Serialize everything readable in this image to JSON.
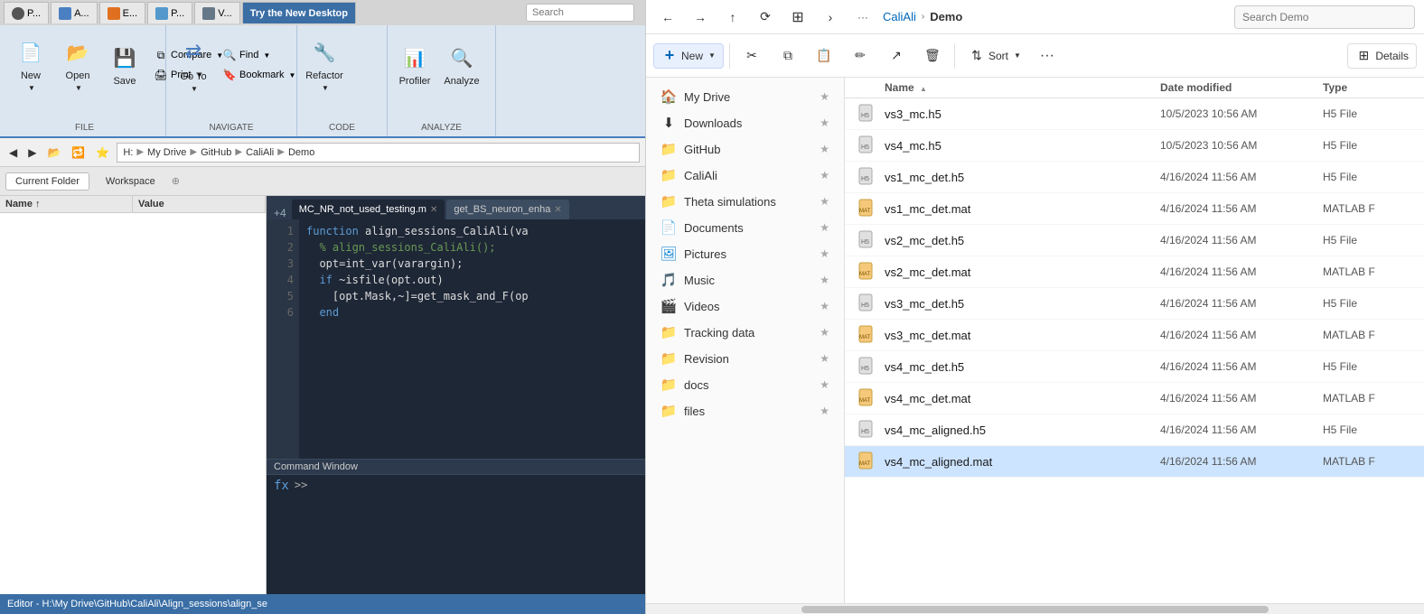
{
  "tabs": [
    {
      "id": "p1",
      "label": "P...",
      "active": false
    },
    {
      "id": "a1",
      "label": "A...",
      "active": false
    },
    {
      "id": "e1",
      "label": "E...",
      "active": false
    },
    {
      "id": "p2",
      "label": "P...",
      "active": false
    },
    {
      "id": "v1",
      "label": "V...",
      "active": false
    },
    {
      "id": "try",
      "label": "Try the New Desktop",
      "active": true,
      "highlight": true
    }
  ],
  "ribbon": {
    "search_placeholder": "Search",
    "groups": [
      {
        "label": "FILE",
        "buttons_large": [
          {
            "id": "new",
            "label": "New",
            "icon": "📄"
          },
          {
            "id": "open",
            "label": "Open",
            "icon": "📂"
          },
          {
            "id": "save",
            "label": "Save",
            "icon": "💾"
          }
        ],
        "buttons_small": [
          {
            "id": "compare",
            "label": "Compare"
          },
          {
            "id": "print",
            "label": "Print"
          }
        ]
      },
      {
        "label": "NAVIGATE",
        "buttons_large": [
          {
            "id": "goto",
            "label": "Go To",
            "icon": "→"
          }
        ],
        "buttons_small": [
          {
            "id": "find",
            "label": "Find"
          },
          {
            "id": "bookmark",
            "label": "Bookmark"
          }
        ]
      },
      {
        "label": "CODE",
        "buttons_large": [
          {
            "id": "refactor",
            "label": "Refactor",
            "icon": "🔧"
          }
        ]
      },
      {
        "label": "ANALYZE",
        "buttons_large": [
          {
            "id": "profiler",
            "label": "Profiler",
            "icon": "📊"
          },
          {
            "id": "analyze",
            "label": "Analyze",
            "icon": "🔍"
          }
        ]
      }
    ]
  },
  "address_bar": {
    "path_parts": [
      "H:",
      "My Drive",
      "GitHub",
      "CaliAli",
      "Demo"
    ],
    "nav_buttons": [
      "◀",
      "▶",
      "▲",
      "⟳"
    ]
  },
  "panels": [
    {
      "id": "current_folder",
      "label": "Current Folder"
    },
    {
      "id": "workspace",
      "label": "Workspace"
    }
  ],
  "variable_panel": {
    "columns": [
      "Name",
      "Value"
    ],
    "rows": []
  },
  "editor": {
    "tabs": [
      {
        "id": "mc_nr",
        "label": "MC_NR_not_used_testing.m",
        "active": true,
        "closeable": true
      },
      {
        "id": "get_bs",
        "label": "get_BS_neuron_enha",
        "active": false,
        "closeable": true
      }
    ],
    "line_indicator": "+4",
    "lines": [
      {
        "num": "1",
        "content": "function align_sessions_CaliAli(va",
        "type": "kw"
      },
      {
        "num": "2",
        "content": "  % align_sessions_CaliAli();",
        "type": "comment"
      },
      {
        "num": "3",
        "content": "  opt=int_var(varargin);",
        "type": "code"
      },
      {
        "num": "4",
        "content": "  if ~isfile(opt.out)",
        "type": "kw"
      },
      {
        "num": "5",
        "content": "    [opt.Mask,~]=get_mask_and_F(op",
        "type": "code"
      },
      {
        "num": "6",
        "content": "  end",
        "type": "kw"
      }
    ]
  },
  "command_window": {
    "title": "Command Window",
    "prompt": ">>"
  },
  "status_bar": {
    "text": "Editor - H:\\My Drive\\GitHub\\CaliAli\\Align_sessions\\align_se"
  },
  "explorer": {
    "nav_buttons": [
      {
        "id": "back",
        "label": "←",
        "disabled": false
      },
      {
        "id": "forward",
        "label": "→",
        "disabled": false
      },
      {
        "id": "up",
        "label": "↑",
        "disabled": false
      },
      {
        "id": "refresh",
        "label": "⟳",
        "disabled": false
      }
    ],
    "breadcrumb": [
      "CaliAli",
      "Demo"
    ],
    "search_placeholder": "Search Demo",
    "toolbar_buttons": [
      {
        "id": "new",
        "label": "New",
        "icon": "+",
        "has_caret": true
      },
      {
        "id": "cut",
        "label": "",
        "icon": "✂",
        "has_caret": false
      },
      {
        "id": "copy",
        "label": "",
        "icon": "⧉",
        "has_caret": false
      },
      {
        "id": "paste",
        "label": "",
        "icon": "📋",
        "has_caret": false
      },
      {
        "id": "rename",
        "label": "",
        "icon": "✏",
        "has_caret": false
      },
      {
        "id": "share",
        "label": "",
        "icon": "↗",
        "has_caret": false
      },
      {
        "id": "delete",
        "label": "",
        "icon": "🗑",
        "has_caret": false
      },
      {
        "id": "sort",
        "label": "Sort",
        "icon": "⇅",
        "has_caret": true
      }
    ],
    "details_label": "Details",
    "sidebar_items": [
      {
        "id": "my_drive",
        "label": "My Drive",
        "icon": "🏠",
        "pinned": true
      },
      {
        "id": "downloads",
        "label": "Downloads",
        "icon": "⬇",
        "pinned": true
      },
      {
        "id": "github",
        "label": "GitHub",
        "icon": "📁",
        "pinned": true
      },
      {
        "id": "caliAli",
        "label": "CaliAli",
        "icon": "📁",
        "pinned": true
      },
      {
        "id": "theta_sim",
        "label": "Theta simulations",
        "icon": "📁",
        "pinned": true
      },
      {
        "id": "documents",
        "label": "Documents",
        "icon": "📄",
        "pinned": true
      },
      {
        "id": "pictures",
        "label": "Pictures",
        "icon": "🖼",
        "pinned": true
      },
      {
        "id": "music",
        "label": "Music",
        "icon": "🎵",
        "pinned": true
      },
      {
        "id": "videos",
        "label": "Videos",
        "icon": "🎬",
        "pinned": true
      },
      {
        "id": "tracking_data",
        "label": "Tracking data",
        "icon": "📁",
        "pinned": true
      },
      {
        "id": "revision",
        "label": "Revision",
        "icon": "📁",
        "pinned": true
      },
      {
        "id": "docs",
        "label": "docs",
        "icon": "📁",
        "pinned": true
      },
      {
        "id": "files",
        "label": "files",
        "icon": "📁",
        "pinned": true
      }
    ],
    "file_columns": [
      "Name",
      "Date modified",
      "Type"
    ],
    "files": [
      {
        "id": "vs3_mc_h5",
        "name": "vs3_mc.h5",
        "date": "10/5/2023 10:56 AM",
        "type": "H5 File",
        "icon": "h5",
        "selected": false
      },
      {
        "id": "vs4_mc_h5",
        "name": "vs4_mc.h5",
        "date": "10/5/2023 10:56 AM",
        "type": "H5 File",
        "icon": "h5",
        "selected": false
      },
      {
        "id": "vs1_mc_det_h5",
        "name": "vs1_mc_det.h5",
        "date": "4/16/2024 11:56 AM",
        "type": "H5 File",
        "icon": "h5",
        "selected": false
      },
      {
        "id": "vs1_mc_det_mat",
        "name": "vs1_mc_det.mat",
        "date": "4/16/2024 11:56 AM",
        "type": "MATLAB F",
        "icon": "mat",
        "selected": false
      },
      {
        "id": "vs2_mc_det_h5",
        "name": "vs2_mc_det.h5",
        "date": "4/16/2024 11:56 AM",
        "type": "H5 File",
        "icon": "h5",
        "selected": false
      },
      {
        "id": "vs2_mc_det_mat",
        "name": "vs2_mc_det.mat",
        "date": "4/16/2024 11:56 AM",
        "type": "MATLAB F",
        "icon": "mat",
        "selected": false
      },
      {
        "id": "vs3_mc_det_h5",
        "name": "vs3_mc_det.h5",
        "date": "4/16/2024 11:56 AM",
        "type": "H5 File",
        "icon": "h5",
        "selected": false
      },
      {
        "id": "vs3_mc_det_mat",
        "name": "vs3_mc_det.mat",
        "date": "4/16/2024 11:56 AM",
        "type": "MATLAB F",
        "icon": "mat",
        "selected": false
      },
      {
        "id": "vs4_mc_det_h5",
        "name": "vs4_mc_det.h5",
        "date": "4/16/2024 11:56 AM",
        "type": "H5 File",
        "icon": "h5",
        "selected": false
      },
      {
        "id": "vs4_mc_det_mat",
        "name": "vs4_mc_det.mat",
        "date": "4/16/2024 11:56 AM",
        "type": "MATLAB F",
        "icon": "mat",
        "selected": false
      },
      {
        "id": "vs4_mc_aligned_h5",
        "name": "vs4_mc_aligned.h5",
        "date": "4/16/2024 11:56 AM",
        "type": "H5 File",
        "icon": "h5",
        "selected": false
      },
      {
        "id": "vs4_mc_aligned_mat",
        "name": "vs4_mc_aligned.mat",
        "date": "4/16/2024 11:56 AM",
        "type": "MATLAB F",
        "icon": "mat",
        "selected": true
      }
    ]
  }
}
